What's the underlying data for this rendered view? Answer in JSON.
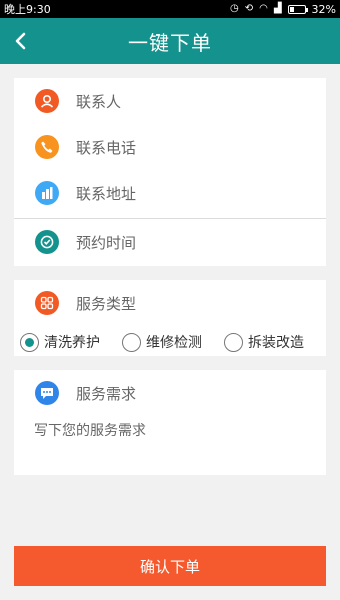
{
  "statusbar": {
    "time": "晚上9:30",
    "battery": "32%",
    "battery_level": 0.32
  },
  "header": {
    "title": "一键下单"
  },
  "contact": {
    "name_label": "联系人",
    "phone_label": "联系电话",
    "address_label": "联系地址",
    "appointment_label": "预约时间"
  },
  "service_type": {
    "label": "服务类型",
    "options": [
      "清洗养护",
      "维修检测",
      "拆装改造"
    ],
    "selected": "清洗养护"
  },
  "service_needs": {
    "label": "服务需求",
    "placeholder": "写下您的服务需求"
  },
  "submit": {
    "label": "确认下单"
  },
  "colors": {
    "header": "#14928e",
    "person_icon": "#f15a24",
    "phone_icon": "#f7931e",
    "address_icon": "#3fa9f5",
    "clock_icon": "#14928e",
    "grid_icon": "#f15a24",
    "chat_icon": "#2f86e8",
    "submit": "#f55a2e"
  }
}
